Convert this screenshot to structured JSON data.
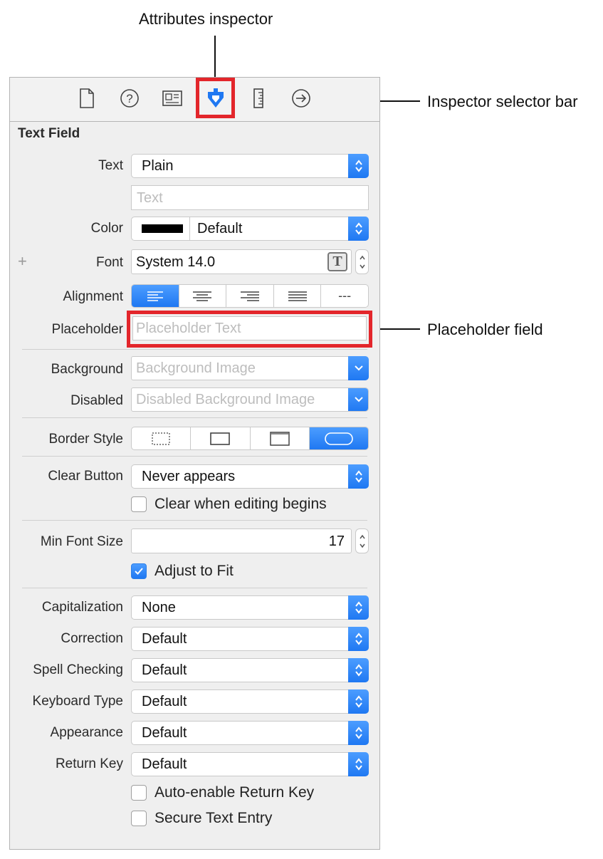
{
  "callouts": {
    "attributes_inspector": "Attributes inspector",
    "selector_bar": "Inspector selector bar",
    "placeholder_field": "Placeholder field"
  },
  "selector_icons": [
    "file-icon",
    "help-icon",
    "identity-icon",
    "attributes-icon",
    "size-icon",
    "connections-icon"
  ],
  "accent": "#1f78f2",
  "highlight": "#e3262b",
  "inspector": {
    "title": "Text Field",
    "text": {
      "label": "Text",
      "value": "Plain",
      "text_placeholder": "Text"
    },
    "color": {
      "label": "Color",
      "value": "Default",
      "swatch": "#000000"
    },
    "font": {
      "plus": "+",
      "label": "Font",
      "value": "System 14.0"
    },
    "alignment": {
      "label": "Alignment",
      "selected": "left",
      "last": "---"
    },
    "placeholder": {
      "label": "Placeholder",
      "placeholder": "Placeholder Text"
    },
    "background": {
      "label": "Background",
      "placeholder": "Background Image"
    },
    "disabled": {
      "label": "Disabled",
      "placeholder": "Disabled Background Image"
    },
    "border_style": {
      "label": "Border Style",
      "selected": "rounded"
    },
    "clear_button": {
      "label": "Clear Button",
      "value": "Never appears"
    },
    "clear_when_editing": {
      "label": "Clear when editing begins",
      "checked": false
    },
    "min_font_size": {
      "label": "Min Font Size",
      "value": "17"
    },
    "adjust_to_fit": {
      "label": "Adjust to Fit",
      "checked": true
    },
    "capitalization": {
      "label": "Capitalization",
      "value": "None"
    },
    "correction": {
      "label": "Correction",
      "value": "Default"
    },
    "spell_checking": {
      "label": "Spell Checking",
      "value": "Default"
    },
    "keyboard_type": {
      "label": "Keyboard Type",
      "value": "Default"
    },
    "appearance": {
      "label": "Appearance",
      "value": "Default"
    },
    "return_key": {
      "label": "Return Key",
      "value": "Default"
    },
    "auto_enable_return": {
      "label": "Auto-enable Return Key",
      "checked": false
    },
    "secure_text_entry": {
      "label": "Secure Text Entry",
      "checked": false
    }
  }
}
